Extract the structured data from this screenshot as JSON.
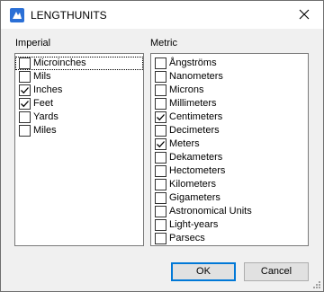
{
  "window": {
    "title": "LENGTHUNITS"
  },
  "imperial": {
    "label": "Imperial",
    "items": [
      {
        "label": "Microinches",
        "checked": false
      },
      {
        "label": "Mils",
        "checked": false
      },
      {
        "label": "Inches",
        "checked": true
      },
      {
        "label": "Feet",
        "checked": true
      },
      {
        "label": "Yards",
        "checked": false
      },
      {
        "label": "Miles",
        "checked": false
      }
    ]
  },
  "metric": {
    "label": "Metric",
    "items": [
      {
        "label": "Ångströms",
        "checked": false
      },
      {
        "label": "Nanometers",
        "checked": false
      },
      {
        "label": "Microns",
        "checked": false
      },
      {
        "label": "Millimeters",
        "checked": false
      },
      {
        "label": "Centimeters",
        "checked": true
      },
      {
        "label": "Decimeters",
        "checked": false
      },
      {
        "label": "Meters",
        "checked": true
      },
      {
        "label": "Dekameters",
        "checked": false
      },
      {
        "label": "Hectometers",
        "checked": false
      },
      {
        "label": "Kilometers",
        "checked": false
      },
      {
        "label": "Gigameters",
        "checked": false
      },
      {
        "label": "Astronomical Units",
        "checked": false
      },
      {
        "label": "Light-years",
        "checked": false
      },
      {
        "label": "Parsecs",
        "checked": false
      }
    ]
  },
  "buttons": {
    "ok": "OK",
    "cancel": "Cancel"
  },
  "colors": {
    "accent": "#0078d7",
    "list_bg": "#ffffff",
    "dialog_bg": "#f0f0f0"
  }
}
